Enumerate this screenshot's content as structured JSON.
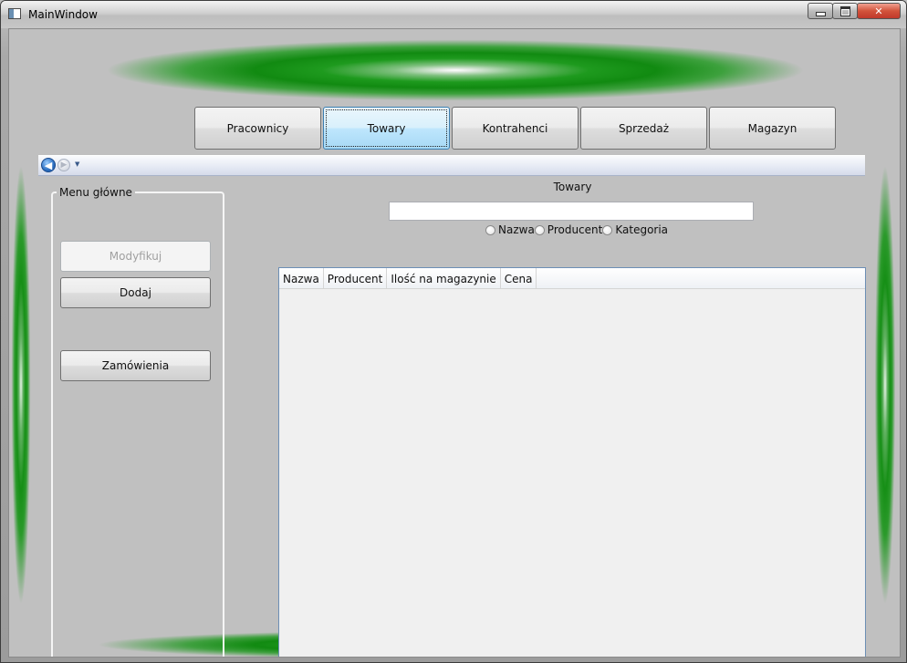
{
  "window": {
    "title": "MainWindow",
    "controls": [
      "minimize",
      "maximize",
      "close"
    ]
  },
  "nav_buttons": [
    {
      "label": "Pracownicy",
      "active": false
    },
    {
      "label": "Towary",
      "active": true
    },
    {
      "label": "Kontrahenci",
      "active": false
    },
    {
      "label": "Sprzedaż",
      "active": false
    },
    {
      "label": "Magazyn",
      "active": false
    }
  ],
  "nav_strip": {
    "icons": [
      "back-arrow-icon",
      "forward-arrow-icon",
      "dropdown-icon"
    ]
  },
  "menu": {
    "title": "Menu główne",
    "buttons": [
      {
        "label": "Modyfikuj",
        "enabled": false
      },
      {
        "label": "Dodaj",
        "enabled": true
      },
      {
        "label": "Zamówienia",
        "enabled": true
      }
    ]
  },
  "search": {
    "section_label": "Towary",
    "value": "",
    "radio_options": [
      "Nazwa",
      "Producent",
      "Kategoria"
    ]
  },
  "grid": {
    "columns": [
      "Nazwa",
      "Producent",
      "Ilość na magazynie",
      "Cena"
    ],
    "rows": []
  },
  "colors": {
    "glow": "#118a11",
    "background": "#c0c0c0",
    "active_tab": "#bee6fd"
  }
}
